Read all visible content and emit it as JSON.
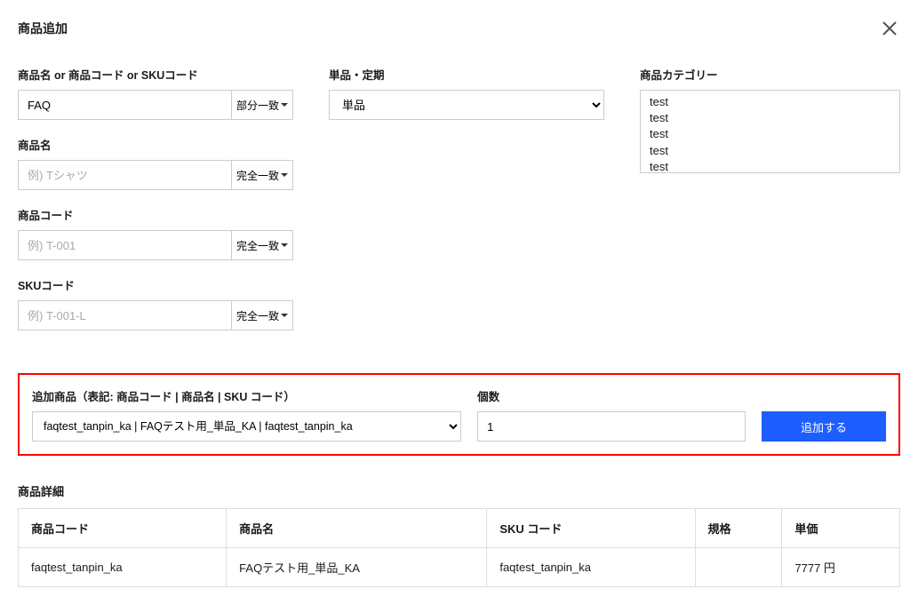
{
  "header": {
    "title": "商品追加"
  },
  "filters": {
    "name_or_code": {
      "label": "商品名 or 商品コード or SKUコード",
      "value": "FAQ",
      "match": "部分一致"
    },
    "product_name": {
      "label": "商品名",
      "placeholder": "例) Tシャツ",
      "value": "",
      "match": "完全一致"
    },
    "product_code": {
      "label": "商品コード",
      "placeholder": "例) T-001",
      "value": "",
      "match": "完全一致"
    },
    "sku_code": {
      "label": "SKUコード",
      "placeholder": "例) T-001-L",
      "value": "",
      "match": "完全一致"
    },
    "single_recurring": {
      "label": "単品・定期",
      "selected": "単品"
    },
    "category": {
      "label": "商品カテゴリー",
      "items": [
        "test",
        "test",
        "test",
        "test",
        "test"
      ]
    }
  },
  "add_section": {
    "product_label": "追加商品（表記: 商品コード | 商品名 | SKU コード）",
    "product_selected": "faqtest_tanpin_ka | FAQテスト用_単品_KA | faqtest_tanpin_ka",
    "qty_label": "個数",
    "qty_value": "1",
    "button_label": "追加する"
  },
  "detail": {
    "title": "商品詳細",
    "headers": {
      "code": "商品コード",
      "name": "商品名",
      "sku": "SKU コード",
      "spec": "規格",
      "price": "単価"
    },
    "row": {
      "code": "faqtest_tanpin_ka",
      "name": "FAQテスト用_単品_KA",
      "sku": "faqtest_tanpin_ka",
      "spec": "",
      "price": "7777 円"
    }
  }
}
